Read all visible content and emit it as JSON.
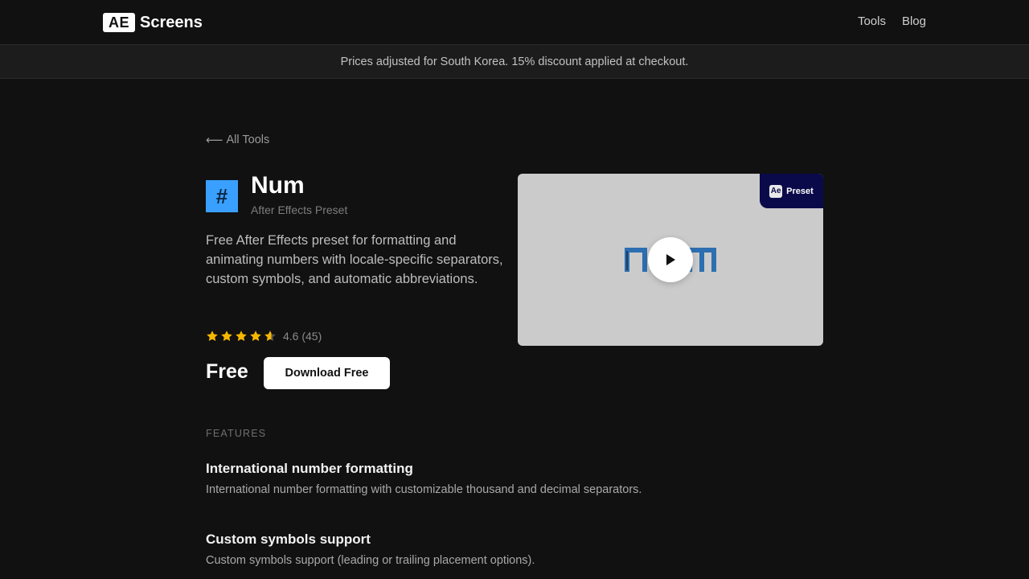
{
  "nav": {
    "logo_box": "AE",
    "logo_text": "Screens",
    "links": [
      "Tools",
      "Blog"
    ]
  },
  "banner": {
    "text": "Prices adjusted for South Korea. 15% discount applied at checkout."
  },
  "back_link": {
    "arrow": "⟵",
    "label": "All Tools"
  },
  "product": {
    "icon_glyph": "#",
    "icon_color": "#3aa0ff",
    "title": "Num",
    "subtitle": "After Effects Preset",
    "description": "Free After Effects preset for formatting and animating numbers with locale-specific separators, custom symbols, and automatic abbreviations.",
    "rating_value": 4.6,
    "rating_text": "4.6 (45)",
    "star_color": "#f5b800",
    "price": "Free",
    "download_label": "Download Free"
  },
  "preview": {
    "badge_icon": "Ae",
    "badge_label": "Preset",
    "badge_color": "#0a0a4a",
    "logo_text": "num",
    "play_icon": "play-icon"
  },
  "features": {
    "heading": "FEATURES",
    "items": [
      {
        "title": "International number formatting",
        "description": "International number formatting with customizable thousand and decimal separators."
      },
      {
        "title": "Custom symbols support",
        "description": "Custom symbols support (leading or trailing placement options)."
      }
    ]
  }
}
